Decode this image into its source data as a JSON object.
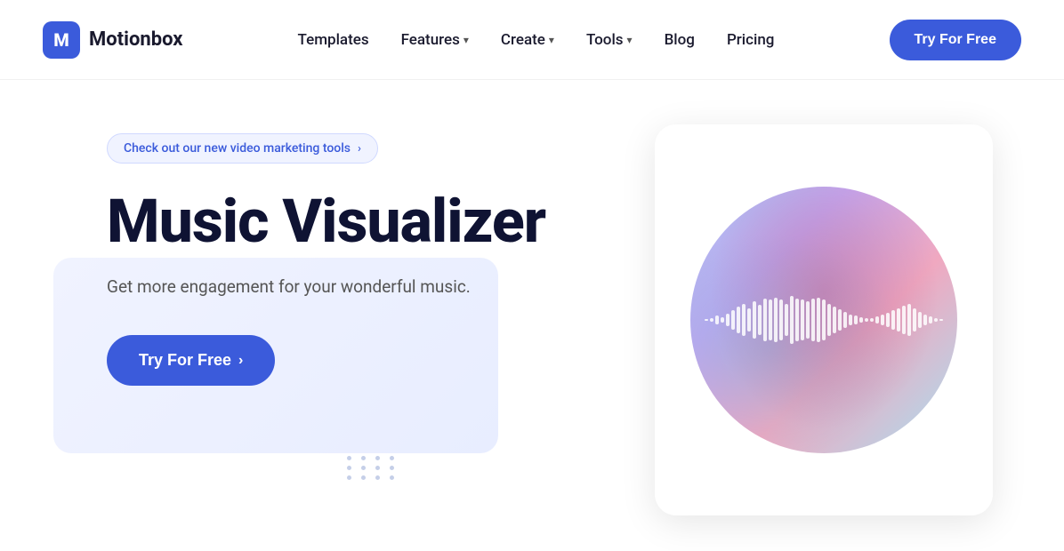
{
  "brand": {
    "logo_letter": "M",
    "name": "Motionbox"
  },
  "nav": {
    "links": [
      {
        "label": "Templates",
        "has_dropdown": false
      },
      {
        "label": "Features",
        "has_dropdown": true
      },
      {
        "label": "Create",
        "has_dropdown": true
      },
      {
        "label": "Tools",
        "has_dropdown": true
      },
      {
        "label": "Blog",
        "has_dropdown": false
      },
      {
        "label": "Pricing",
        "has_dropdown": false
      }
    ],
    "cta_label": "Try For Free"
  },
  "hero": {
    "badge_text": "Check out our new video marketing tools",
    "badge_chevron": "›",
    "title": "Music Visualizer",
    "subtitle": "Get more engagement for your wonderful music.",
    "cta_label": "Try For Free",
    "cta_chevron": "›"
  },
  "colors": {
    "accent": "#3b5bdb",
    "title": "#0f1333",
    "badge_bg": "#f0f3ff"
  },
  "waveform": {
    "bars": [
      2,
      4,
      8,
      5,
      12,
      18,
      25,
      30,
      22,
      35,
      28,
      40,
      38,
      42,
      38,
      30,
      45,
      40,
      38,
      35,
      40,
      42,
      38,
      30,
      25,
      20,
      15,
      10,
      8,
      5,
      3,
      4,
      7,
      10,
      14,
      18,
      22,
      26,
      30,
      22,
      15,
      10,
      7,
      4,
      2
    ]
  }
}
